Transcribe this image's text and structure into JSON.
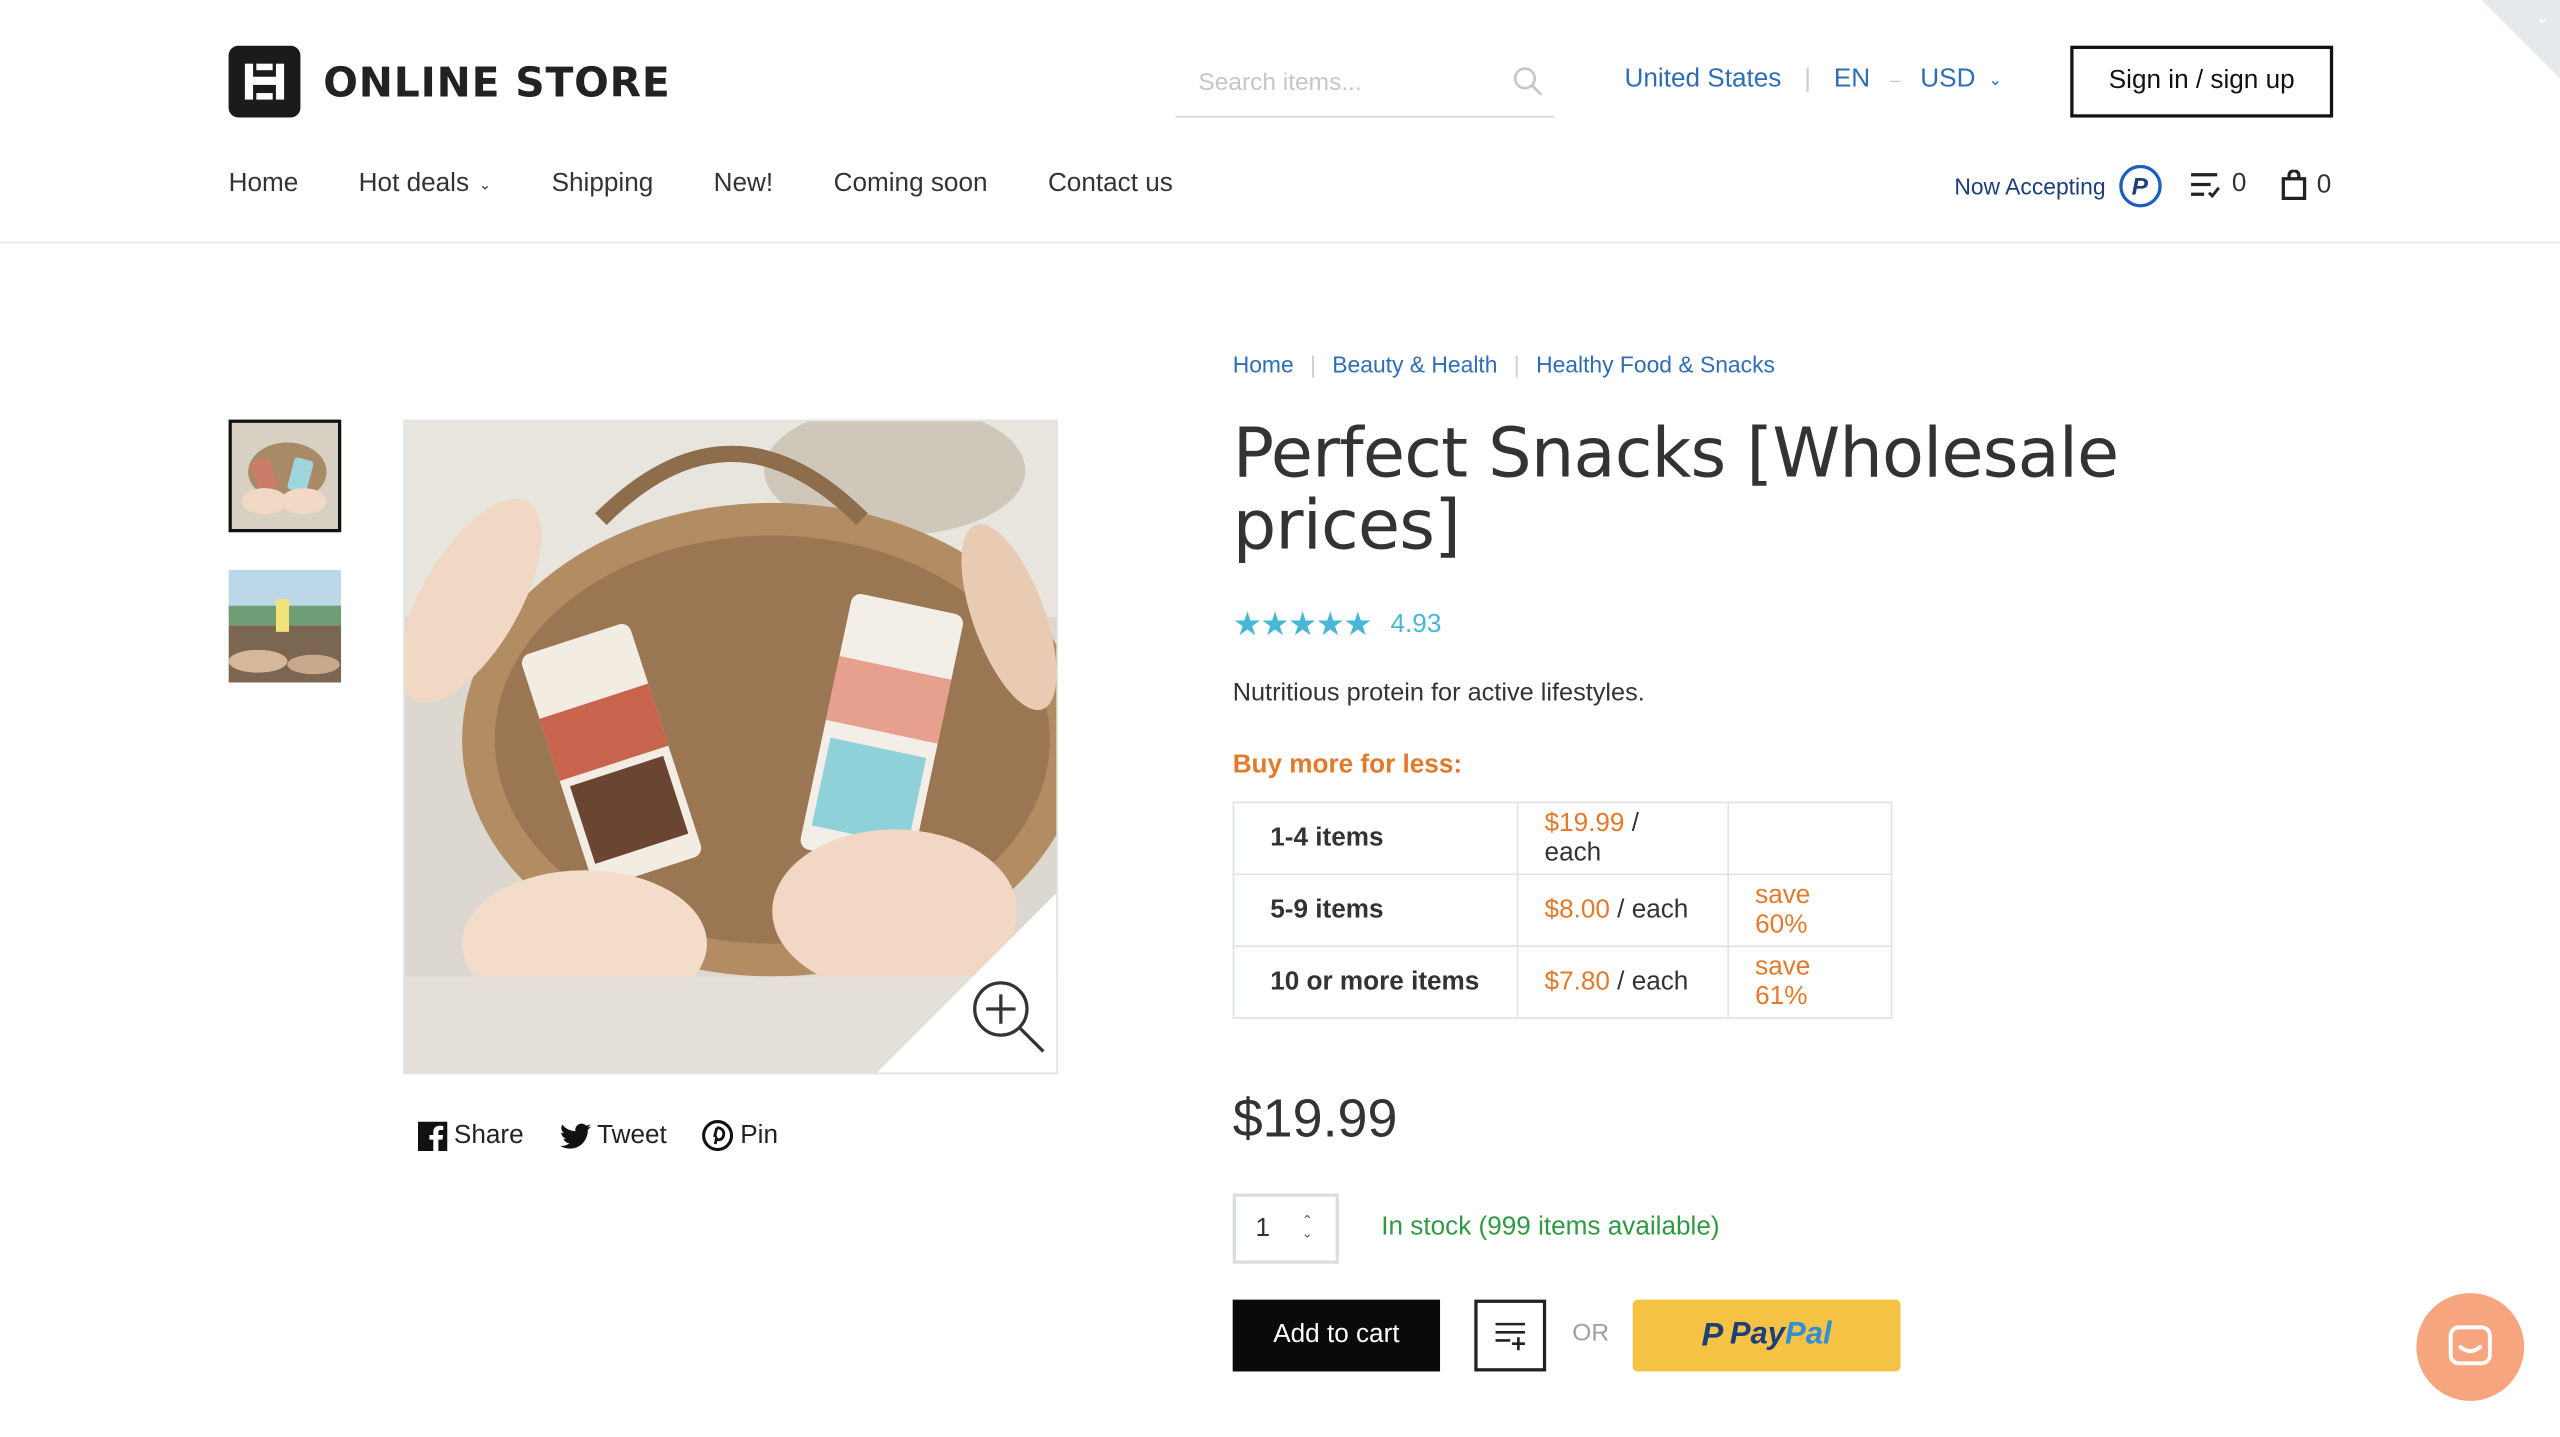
{
  "header": {
    "brand": "ONLINE STORE",
    "search_placeholder": "Search items...",
    "country": "United States",
    "language": "EN",
    "currency": "USD",
    "signin_label": "Sign in / sign up",
    "now_accepting": "Now Accepting",
    "wishlist_count": "0",
    "cart_count": "0"
  },
  "nav": {
    "items": [
      "Home",
      "Hot deals",
      "Shipping",
      "New!",
      "Coming soon",
      "Contact us"
    ]
  },
  "breadcrumb": [
    "Home",
    "Beauty & Health",
    "Healthy Food & Snacks"
  ],
  "product": {
    "title": "Perfect Snacks [Wholesale prices]",
    "rating": "4.93",
    "stars": 5,
    "tagline": "Nutritious protein for active lifestyles.",
    "buy_more_label": "Buy more for less:",
    "tiers": [
      {
        "qty": "1-4 items",
        "price": "$19.99",
        "unit": " / each",
        "save": ""
      },
      {
        "qty": "5-9 items",
        "price": "$8.00",
        "unit": " / each",
        "save": "save 60%"
      },
      {
        "qty": "10 or more items",
        "price": "$7.80",
        "unit": " / each",
        "save": "save 61%"
      }
    ],
    "price": "$19.99",
    "quantity": "1",
    "stock": "In stock (999 items available)",
    "add_to_cart": "Add to cart",
    "or_label": "OR",
    "paypal_pay": "Pay",
    "paypal_pal": "Pal"
  },
  "share": {
    "share": "Share",
    "tweet": "Tweet",
    "pin": "Pin"
  },
  "colors": {
    "link_blue": "#2f6db5",
    "accent_orange": "#e5792b",
    "star_blue": "#47b7d6",
    "stock_green": "#2f9a43",
    "paypal_yellow": "#f6c244",
    "chat_orange": "#f6a57e"
  }
}
